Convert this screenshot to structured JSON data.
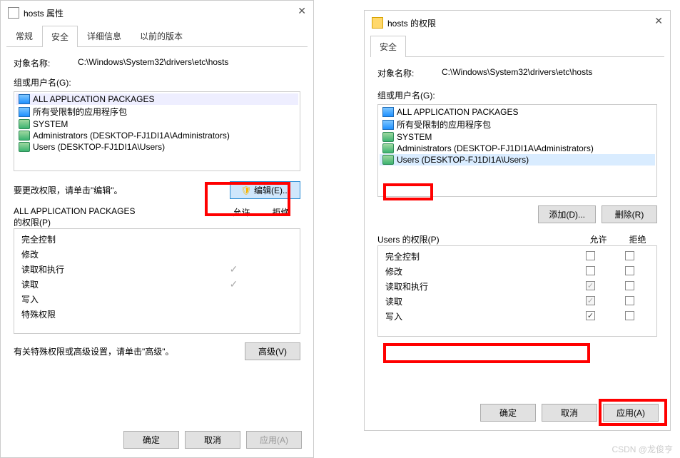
{
  "win1": {
    "title": "hosts 属性",
    "tabs": [
      "常规",
      "安全",
      "详细信息",
      "以前的版本"
    ],
    "active_tab": 1,
    "obj_label": "对象名称:",
    "obj_path": "C:\\Windows\\System32\\drivers\\etc\\hosts",
    "group_label": "组或用户名(G):",
    "groups": [
      "ALL APPLICATION PACKAGES",
      "所有受限制的应用程序包",
      "SYSTEM",
      "Administrators (DESKTOP-FJ1DI1A\\Administrators)",
      "Users (DESKTOP-FJ1DI1A\\Users)"
    ],
    "edit_hint": "要更改权限，请单击\"编辑\"。",
    "edit_btn": "编辑(E)...",
    "perm_title": "ALL APPLICATION PACKAGES",
    "perm_of": "的权限(P)",
    "allow": "允许",
    "deny": "拒绝",
    "perms": [
      {
        "name": "完全控制",
        "allow": false
      },
      {
        "name": "修改",
        "allow": false
      },
      {
        "name": "读取和执行",
        "allow": true
      },
      {
        "name": "读取",
        "allow": true
      },
      {
        "name": "写入",
        "allow": false
      },
      {
        "name": "特殊权限",
        "allow": false
      }
    ],
    "adv_hint": "有关特殊权限或高级设置，请单击\"高级\"。",
    "adv_btn": "高级(V)",
    "ok": "确定",
    "cancel": "取消",
    "apply": "应用(A)"
  },
  "win2": {
    "title": "hosts 的权限",
    "tab": "安全",
    "obj_label": "对象名称:",
    "obj_path": "C:\\Windows\\System32\\drivers\\etc\\hosts",
    "group_label": "组或用户名(G):",
    "groups": [
      "ALL APPLICATION PACKAGES",
      "所有受限制的应用程序包",
      "SYSTEM",
      "Administrators (DESKTOP-FJ1DI1A\\Administrators)",
      "Users (DESKTOP-FJ1DI1A\\Users)"
    ],
    "add_btn": "添加(D)...",
    "remove_btn": "删除(R)",
    "perm_title": "Users 的权限(P)",
    "allow": "允许",
    "deny": "拒绝",
    "perms": [
      {
        "name": "完全控制",
        "allow": false,
        "deny": false,
        "grey": false
      },
      {
        "name": "修改",
        "allow": false,
        "deny": false,
        "grey": false
      },
      {
        "name": "读取和执行",
        "allow": true,
        "deny": false,
        "grey": true
      },
      {
        "name": "读取",
        "allow": true,
        "deny": false,
        "grey": true
      },
      {
        "name": "写入",
        "allow": true,
        "deny": false,
        "grey": false
      }
    ],
    "ok": "确定",
    "cancel": "取消",
    "apply": "应用(A)"
  },
  "watermark": "CSDN @龙俊亨"
}
